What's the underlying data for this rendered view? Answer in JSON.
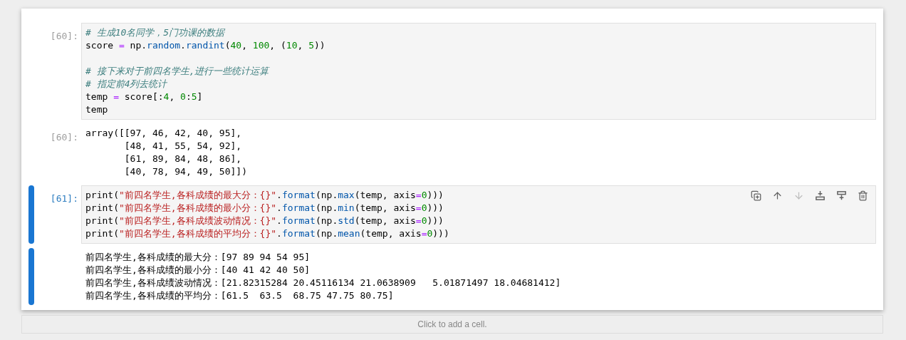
{
  "cells": [
    {
      "kind": "code",
      "prompt": "[60]:",
      "selected": false,
      "lines": [
        {
          "kind": "code",
          "tokens": [
            {
              "kind": "comment",
              "text": "# 生成10名同学，5门功课的数据"
            }
          ]
        },
        {
          "kind": "code",
          "tokens": [
            {
              "kind": "text",
              "text": "score "
            },
            {
              "kind": "op",
              "text": "="
            },
            {
              "kind": "text",
              "text": " np."
            },
            {
              "kind": "attr",
              "text": "random"
            },
            {
              "kind": "text",
              "text": "."
            },
            {
              "kind": "attr",
              "text": "randint"
            },
            {
              "kind": "text",
              "text": "("
            },
            {
              "kind": "num",
              "text": "40"
            },
            {
              "kind": "text",
              "text": ", "
            },
            {
              "kind": "num",
              "text": "100"
            },
            {
              "kind": "text",
              "text": ", ("
            },
            {
              "kind": "num",
              "text": "10"
            },
            {
              "kind": "text",
              "text": ", "
            },
            {
              "kind": "num",
              "text": "5"
            },
            {
              "kind": "text",
              "text": "))"
            }
          ]
        },
        {
          "kind": "blank"
        },
        {
          "kind": "code",
          "tokens": [
            {
              "kind": "comment",
              "text": "# 接下来对于前四名学生,进行一些统计运算"
            }
          ]
        },
        {
          "kind": "code",
          "tokens": [
            {
              "kind": "comment",
              "text": "# 指定前4列去统计"
            }
          ]
        },
        {
          "kind": "code",
          "tokens": [
            {
              "kind": "text",
              "text": "temp "
            },
            {
              "kind": "op",
              "text": "="
            },
            {
              "kind": "text",
              "text": " score[:"
            },
            {
              "kind": "num",
              "text": "4"
            },
            {
              "kind": "text",
              "text": ", "
            },
            {
              "kind": "num",
              "text": "0"
            },
            {
              "kind": "text",
              "text": ":"
            },
            {
              "kind": "num",
              "text": "5"
            },
            {
              "kind": "text",
              "text": "]"
            }
          ]
        },
        {
          "kind": "code",
          "tokens": [
            {
              "kind": "text",
              "text": "temp"
            }
          ]
        }
      ]
    },
    {
      "kind": "output",
      "prompt": "[60]:",
      "selected": false,
      "lines": [
        "array([[97, 46, 42, 40, 95],",
        "       [48, 41, 55, 54, 92],",
        "       [61, 89, 84, 48, 86],",
        "       [40, 78, 94, 49, 50]])"
      ]
    },
    {
      "kind": "code",
      "prompt": "[61]:",
      "selected": true,
      "toolbar": [
        {
          "kind": "duplicate",
          "disabled": false
        },
        {
          "kind": "up",
          "disabled": false
        },
        {
          "kind": "down",
          "disabled": true
        },
        {
          "kind": "insert-above",
          "disabled": false
        },
        {
          "kind": "insert-below",
          "disabled": false
        },
        {
          "kind": "delete",
          "disabled": false
        }
      ],
      "lines": [
        {
          "kind": "code",
          "tokens": [
            {
              "kind": "text",
              "text": "print("
            },
            {
              "kind": "str",
              "text": "\"前四名学生,各科成绩的最大分：{}\""
            },
            {
              "kind": "text",
              "text": "."
            },
            {
              "kind": "attr",
              "text": "format"
            },
            {
              "kind": "text",
              "text": "(np."
            },
            {
              "kind": "attr",
              "text": "max"
            },
            {
              "kind": "text",
              "text": "(temp, axis"
            },
            {
              "kind": "op",
              "text": "="
            },
            {
              "kind": "num",
              "text": "0"
            },
            {
              "kind": "text",
              "text": ")))"
            }
          ]
        },
        {
          "kind": "code",
          "tokens": [
            {
              "kind": "text",
              "text": "print("
            },
            {
              "kind": "str",
              "text": "\"前四名学生,各科成绩的最小分：{}\""
            },
            {
              "kind": "text",
              "text": "."
            },
            {
              "kind": "attr",
              "text": "format"
            },
            {
              "kind": "text",
              "text": "(np."
            },
            {
              "kind": "attr",
              "text": "min"
            },
            {
              "kind": "text",
              "text": "(temp, axis"
            },
            {
              "kind": "op",
              "text": "="
            },
            {
              "kind": "num",
              "text": "0"
            },
            {
              "kind": "text",
              "text": ")))"
            }
          ]
        },
        {
          "kind": "code",
          "tokens": [
            {
              "kind": "text",
              "text": "print("
            },
            {
              "kind": "str",
              "text": "\"前四名学生,各科成绩波动情况：{}\""
            },
            {
              "kind": "text",
              "text": "."
            },
            {
              "kind": "attr",
              "text": "format"
            },
            {
              "kind": "text",
              "text": "(np."
            },
            {
              "kind": "attr",
              "text": "std"
            },
            {
              "kind": "text",
              "text": "(temp, axis"
            },
            {
              "kind": "op",
              "text": "="
            },
            {
              "kind": "num",
              "text": "0"
            },
            {
              "kind": "text",
              "text": ")))"
            }
          ]
        },
        {
          "kind": "code",
          "tokens": [
            {
              "kind": "text",
              "text": "print("
            },
            {
              "kind": "str",
              "text": "\"前四名学生,各科成绩的平均分：{}\""
            },
            {
              "kind": "text",
              "text": "."
            },
            {
              "kind": "attr",
              "text": "format"
            },
            {
              "kind": "text",
              "text": "(np."
            },
            {
              "kind": "attr",
              "text": "mean"
            },
            {
              "kind": "text",
              "text": "(temp, axis"
            },
            {
              "kind": "op",
              "text": "="
            },
            {
              "kind": "num",
              "text": "0"
            },
            {
              "kind": "text",
              "text": ")))"
            }
          ]
        }
      ]
    },
    {
      "kind": "output",
      "selected": true,
      "lines": [
        "前四名学生,各科成绩的最大分：[97 89 94 54 95]",
        "前四名学生,各科成绩的最小分：[40 41 42 40 50]",
        "前四名学生,各科成绩波动情况：[21.82315284 20.45116134 21.0638909   5.01871497 18.04681412]",
        "前四名学生,各科成绩的平均分：[61.5  63.5  68.75 47.75 80.75]"
      ]
    }
  ],
  "add_cell": {
    "label": "Click to add a cell."
  }
}
